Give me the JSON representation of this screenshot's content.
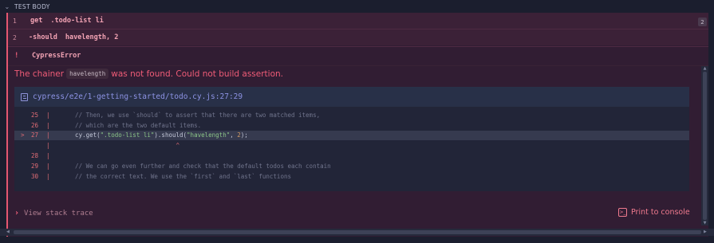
{
  "section": {
    "title": "TEST BODY"
  },
  "commands": [
    {
      "number": "1",
      "name": "get",
      "message": ".todo-list li"
    },
    {
      "number": "2",
      "name": "-should",
      "message": "havelength, 2"
    }
  ],
  "badge": "2",
  "error": {
    "bang": "!",
    "name": "CypressError",
    "message_prefix": "The chainer",
    "message_code": "havelength",
    "message_suffix": "was not found. Could not build assertion."
  },
  "code_frame": {
    "file_link": "cypress/e2e/1-getting-started/todo.cy.js:27:29",
    "lines": [
      {
        "ln": "25",
        "pipe": "|",
        "text": "    // Then, we use `should` to assert that there are two matched items,",
        "kind": "comment"
      },
      {
        "ln": "26",
        "pipe": "|",
        "text": "    // which are the two default items.",
        "kind": "comment"
      },
      {
        "ln": "27",
        "arrow": ">",
        "pipe": "|",
        "kind": "code",
        "tokens": [
          {
            "t": "    cy.get(",
            "c": "txt"
          },
          {
            "t": "\".todo-list li\"",
            "c": "str"
          },
          {
            "t": ").should(",
            "c": "txt"
          },
          {
            "t": "\"havelength\"",
            "c": "str"
          },
          {
            "t": ", ",
            "c": "txt"
          },
          {
            "t": "2",
            "c": "num2"
          },
          {
            "t": ");",
            "c": "txt"
          }
        ]
      },
      {
        "ln": "",
        "pipe": "|",
        "text": "                                ^",
        "kind": "caret"
      },
      {
        "ln": "28",
        "pipe": "|",
        "text": "",
        "kind": "comment"
      },
      {
        "ln": "29",
        "pipe": "|",
        "text": "    // We can go even further and check that the default todos each contain",
        "kind": "comment"
      },
      {
        "ln": "30",
        "pipe": "|",
        "text": "    // the correct text. We use the `first` and `last` functions",
        "kind": "comment"
      }
    ]
  },
  "stack_trace": {
    "label": "View stack trace"
  },
  "print_button": {
    "label": "Print to console"
  },
  "icons": {
    "section": "chevron-down-icon",
    "file": "document-icon",
    "stack": "chevron-right-icon",
    "print": "terminal-icon"
  },
  "colors": {
    "error": "#f05c77",
    "link": "#8d93e4",
    "panel": "#311d33"
  }
}
